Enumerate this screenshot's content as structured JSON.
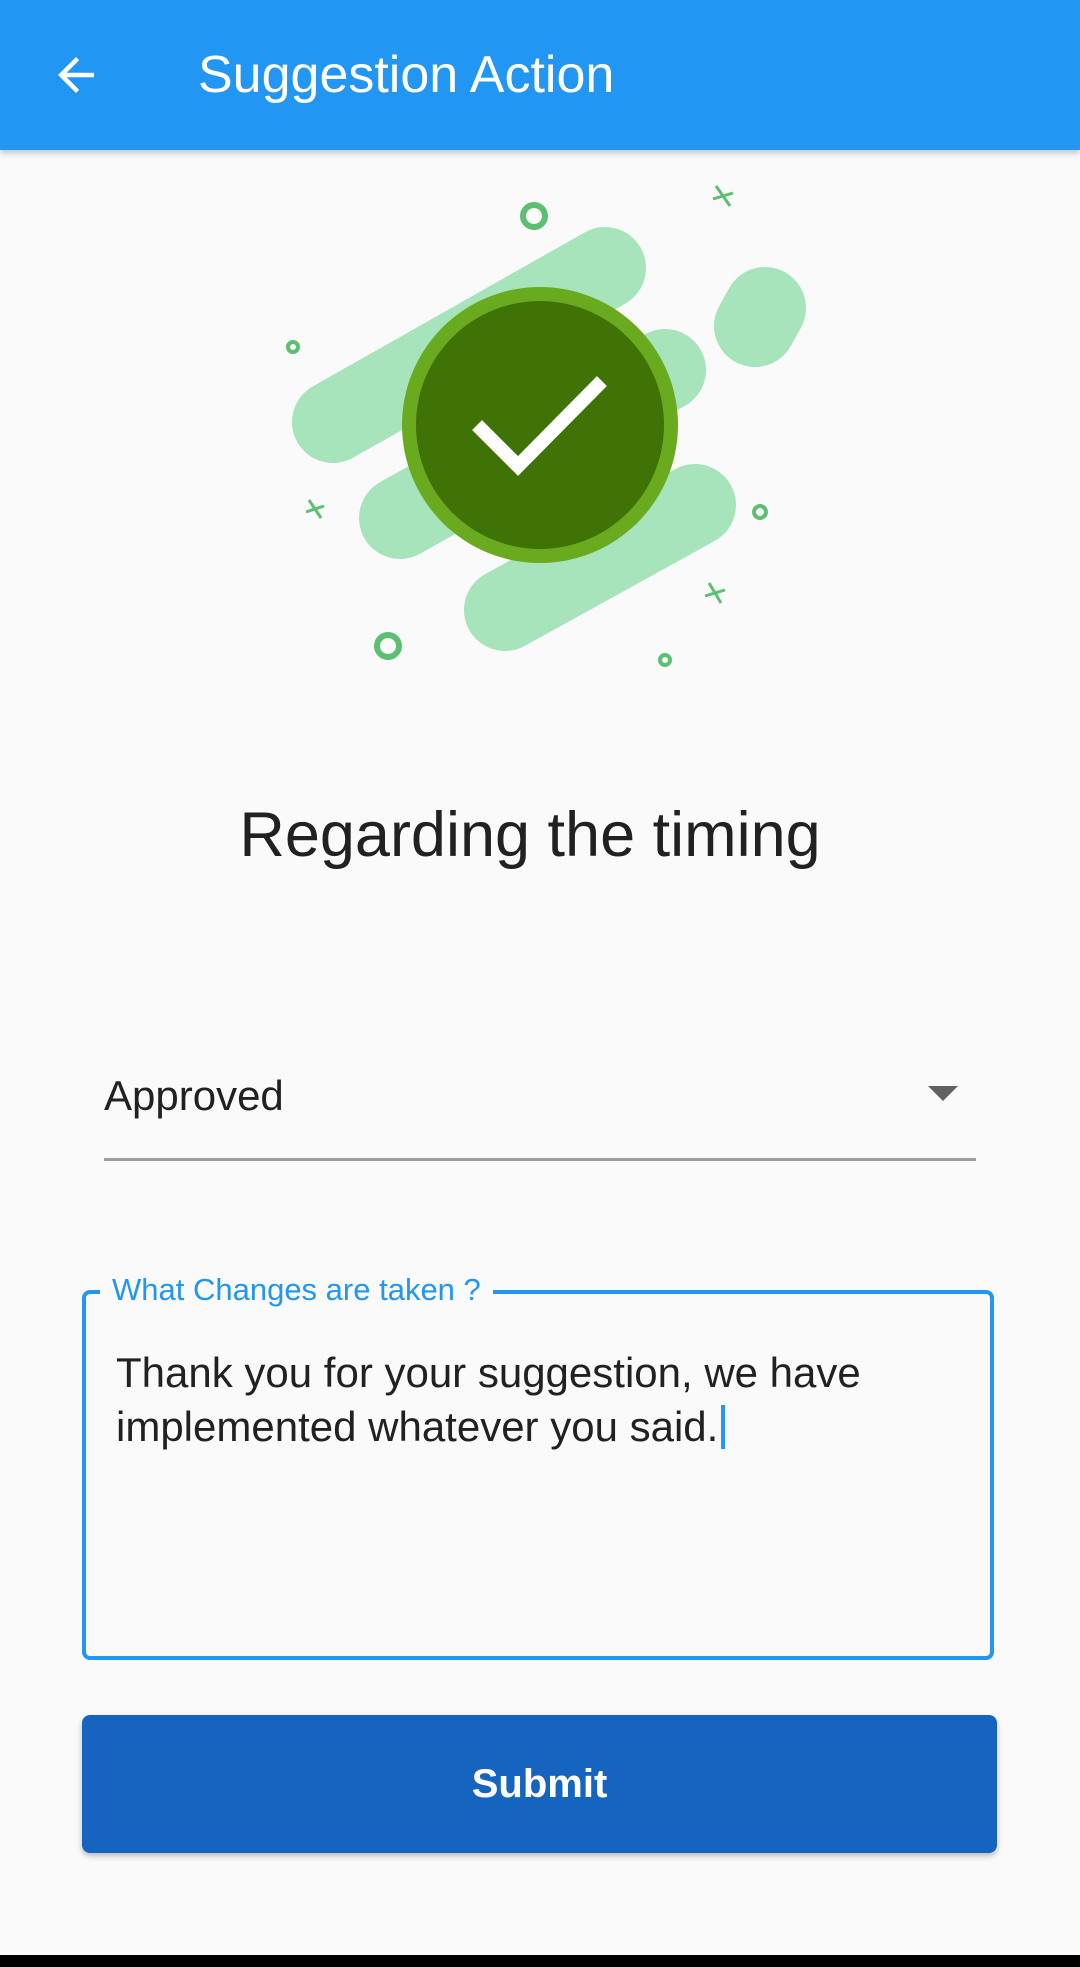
{
  "appbar": {
    "title": "Suggestion Action",
    "back_icon": "arrow-back-icon"
  },
  "hero": {
    "icon": "check-circle-icon"
  },
  "heading": "Regarding the timing",
  "status_dropdown": {
    "selected": "Approved",
    "icon": "arrow-drop-down-icon"
  },
  "changes_field": {
    "label": "What Changes are taken ?",
    "value": "Thank you for your suggestion, we have implemented whatever you said."
  },
  "submit_button": {
    "label": "Submit"
  },
  "colors": {
    "primary": "#2196f3",
    "appbar": "#2196f3",
    "button": "#1565c0",
    "success_dark": "#3f7305",
    "success_ring": "#6aaa1e",
    "success_light": "#a8e4bb"
  }
}
